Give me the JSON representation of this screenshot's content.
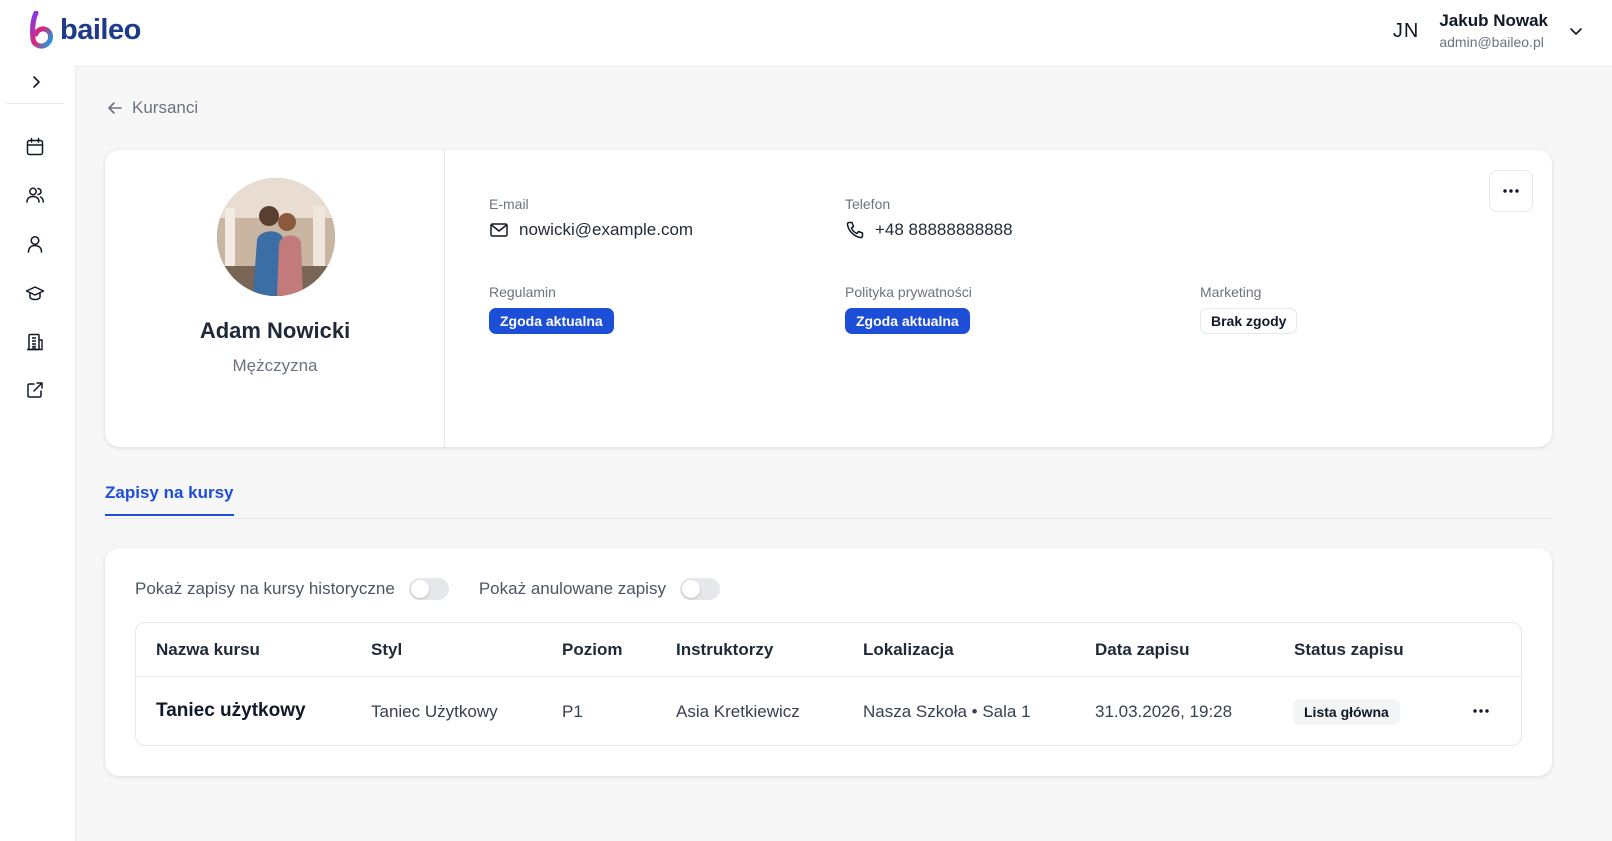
{
  "brand": {
    "name": "baileo",
    "color": "#1e3a8a"
  },
  "user": {
    "initials": "JN",
    "name": "Jakub Nowak",
    "email": "admin@baileo.pl"
  },
  "sidebar": {
    "items": [
      {
        "icon": "calendar-icon"
      },
      {
        "icon": "users-icon"
      },
      {
        "icon": "user-icon"
      },
      {
        "icon": "graduation-cap-icon"
      },
      {
        "icon": "building-icon"
      },
      {
        "icon": "external-link-icon"
      }
    ]
  },
  "breadcrumb": {
    "back_label": "Kursanci"
  },
  "profile": {
    "name": "Adam Nowicki",
    "gender": "Mężczyzna",
    "email_label": "E-mail",
    "email": "nowicki@example.com",
    "phone_label": "Telefon",
    "phone": "+48 88888888888",
    "terms_label": "Regulamin",
    "terms_status": "Zgoda aktualna",
    "privacy_label": "Polityka prywatności",
    "privacy_status": "Zgoda aktualna",
    "marketing_label": "Marketing",
    "marketing_status": "Brak zgody"
  },
  "tabs": {
    "active": "Zapisy na kursy"
  },
  "filters": {
    "historical_label": "Pokaż zapisy na kursy historyczne",
    "historical_on": false,
    "cancelled_label": "Pokaż anulowane zapisy",
    "cancelled_on": false
  },
  "table": {
    "columns": [
      "Nazwa kursu",
      "Styl",
      "Poziom",
      "Instruktorzy",
      "Lokalizacja",
      "Data zapisu",
      "Status zapisu"
    ],
    "rows": [
      {
        "course": "Taniec użytkowy",
        "style": "Taniec Użytkowy",
        "level": "P1",
        "instructors": "Asia Kretkiewicz",
        "location": "Nasza Szkoła • Sala 1",
        "date": "31.03.2026, 19:28",
        "status": "Lista główna"
      }
    ]
  },
  "colors": {
    "accent": "#1d4ed8",
    "background": "#f7f7f8"
  }
}
